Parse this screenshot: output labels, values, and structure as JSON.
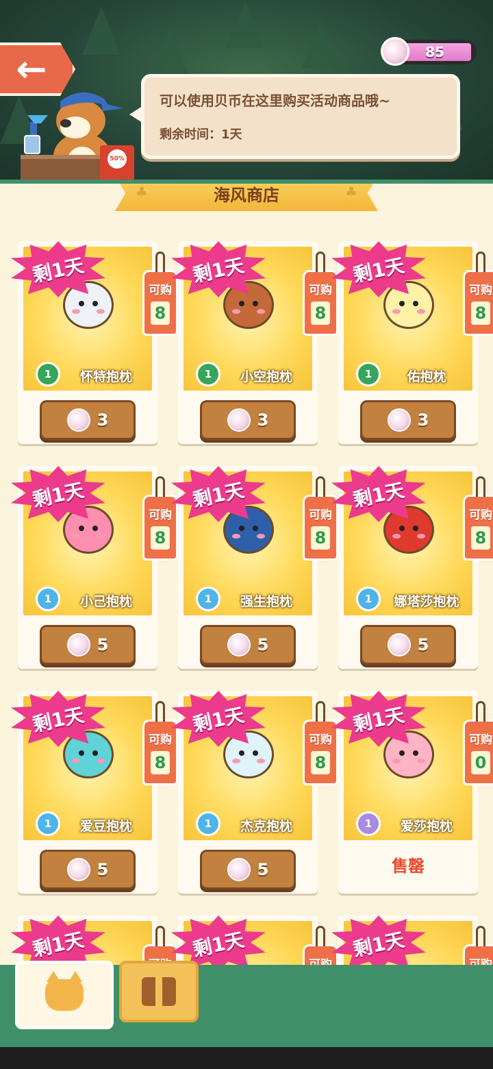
{
  "header": {
    "currency_value": "85",
    "speech_line1": "可以使用贝币在这里购买活动商品哦~",
    "speech_line2": "剩余时间：1天",
    "sale_badge": "50% OFF"
  },
  "shop": {
    "title": "海风商店",
    "buy_label": "可购",
    "sold_out_label": "售罄",
    "days_left_label": "剩1天",
    "items": [
      {
        "name": "怀特抱枕",
        "level": "1",
        "level_color": "green",
        "remaining": "8",
        "price": "3",
        "pet_color": "#eef1f6"
      },
      {
        "name": "小空抱枕",
        "level": "1",
        "level_color": "green",
        "remaining": "8",
        "price": "3",
        "pet_color": "#c46a3a"
      },
      {
        "name": "佑抱枕",
        "level": "1",
        "level_color": "green",
        "remaining": "8",
        "price": "3",
        "pet_color": "#fff1a6"
      },
      {
        "name": "小己抱枕",
        "level": "1",
        "level_color": "blue",
        "remaining": "8",
        "price": "5",
        "pet_color": "#ff8fb0"
      },
      {
        "name": "强生抱枕",
        "level": "1",
        "level_color": "blue",
        "remaining": "8",
        "price": "5",
        "pet_color": "#2f5fa8"
      },
      {
        "name": "娜塔莎抱枕",
        "level": "1",
        "level_color": "blue",
        "remaining": "8",
        "price": "5",
        "pet_color": "#e0392e"
      },
      {
        "name": "爱豆抱枕",
        "level": "1",
        "level_color": "blue",
        "remaining": "8",
        "price": "5",
        "pet_color": "#5fd3d8"
      },
      {
        "name": "杰克抱枕",
        "level": "1",
        "level_color": "blue",
        "remaining": "8",
        "price": "5",
        "pet_color": "#dff3fb"
      },
      {
        "name": "爱莎抱枕",
        "level": "1",
        "level_color": "purple",
        "remaining": "0",
        "price": "",
        "sold_out": true,
        "pet_color": "#ffb4c6"
      },
      {
        "name": "",
        "level": "",
        "remaining": "",
        "price": "",
        "partial": true
      },
      {
        "name": "",
        "level": "",
        "remaining": "",
        "price": "",
        "partial": true
      },
      {
        "name": "",
        "level": "",
        "remaining": "",
        "price": "",
        "partial": true
      }
    ]
  },
  "tabs": [
    {
      "id": "pets",
      "icon": "cat-icon",
      "active": true
    },
    {
      "id": "gifts",
      "icon": "gift-icon",
      "active": false
    }
  ],
  "colors": {
    "panel_bg": "#fbf3dc",
    "accent_green": "#3f8f6a",
    "burst_pink": "#ec3a8c",
    "tag_orange": "#ef6f47",
    "price_brown": "#c2813f"
  }
}
